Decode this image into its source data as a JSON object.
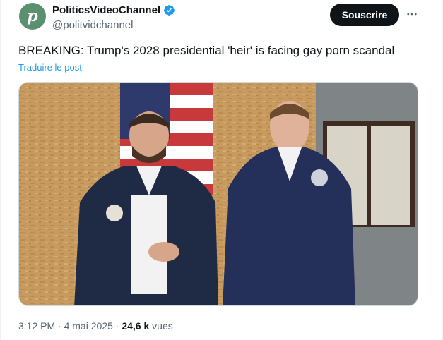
{
  "author": {
    "avatar_letter": "p",
    "display_name": "PoliticsVideoChannel",
    "handle": "@politvidchannel",
    "verified": true
  },
  "actions": {
    "subscribe_label": "Souscrire",
    "more_icon": "more-horizontal-icon"
  },
  "tweet": {
    "text": "BREAKING: Trump's 2028 presidential 'heir' is facing gay porn scandal",
    "translate_label": "Traduire le post"
  },
  "meta": {
    "time": "3:12 PM",
    "separator": "·",
    "date": "4 mai 2025",
    "views_count": "24,6 k",
    "views_label": "vues"
  },
  "colors": {
    "text_primary": "#0f1419",
    "text_secondary": "#536471",
    "link": "#1d9bf0",
    "verified": "#1d9bf0",
    "button_bg": "#0f1419"
  }
}
